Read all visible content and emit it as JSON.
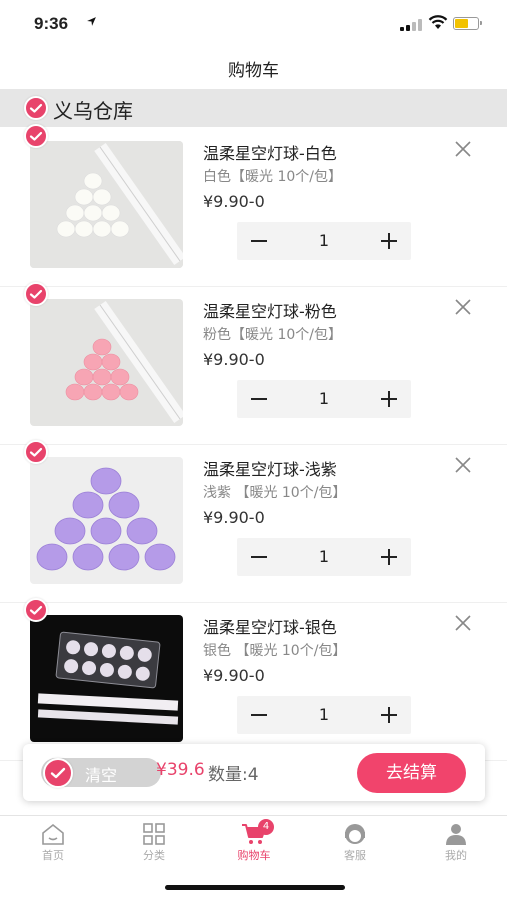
{
  "status_bar": {
    "time": "9:36",
    "battery_color": "#f2c200"
  },
  "nav": {
    "title": "购物车"
  },
  "warehouse": {
    "name": "义乌仓库"
  },
  "colors": {
    "accent": "#e8436b",
    "button": "#f1446c"
  },
  "items": [
    {
      "title": "温柔星空灯球-白色",
      "spec": "白色【暖光 10个/包】",
      "price": "¥9.90-0",
      "qty": "1",
      "image": "white-lantern-balls"
    },
    {
      "title": "温柔星空灯球-粉色",
      "spec": "粉色【暖光 10个/包】",
      "price": "¥9.90-0",
      "qty": "1",
      "image": "pink-lantern-balls"
    },
    {
      "title": "温柔星空灯球-浅紫",
      "spec": "浅紫 【暖光 10个/包】",
      "price": "¥9.90-0",
      "qty": "1",
      "image": "purple-lantern-balls"
    },
    {
      "title": "温柔星空灯球-银色",
      "spec": "银色 【暖光 10个/包】",
      "price": "¥9.90-0",
      "qty": "1",
      "image": "silver-lantern-balls"
    }
  ],
  "checkout": {
    "clear_label": "清空",
    "total": "¥39.6",
    "count": "数量:4",
    "pay_label": "去结算"
  },
  "tabs": [
    {
      "label": "首页",
      "icon": "home-icon"
    },
    {
      "label": "分类",
      "icon": "grid-icon"
    },
    {
      "label": "购物车",
      "icon": "cart-icon",
      "badge": "4",
      "active": true
    },
    {
      "label": "客服",
      "icon": "support-icon"
    },
    {
      "label": "我的",
      "icon": "user-icon"
    }
  ]
}
